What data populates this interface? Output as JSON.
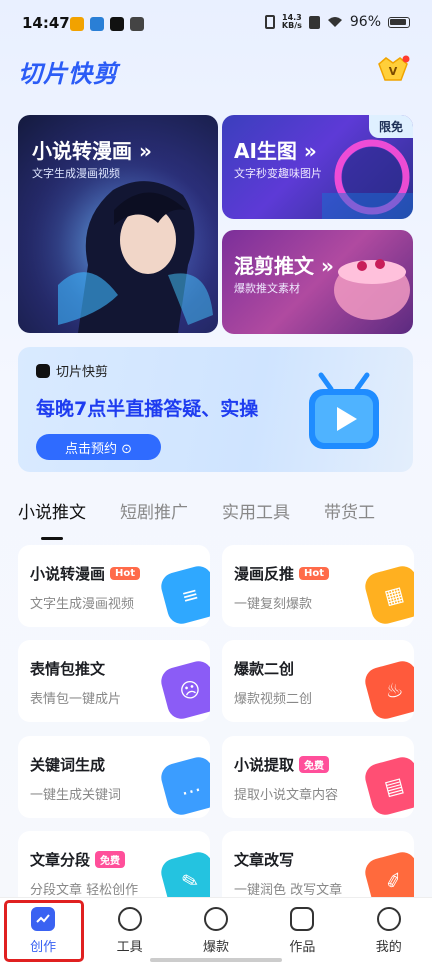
{
  "status": {
    "time": "14:47",
    "net_speed_top": "14.3",
    "net_speed_bottom": "KB/s",
    "battery": "96%"
  },
  "header": {
    "app_title": "切片快剪"
  },
  "hero": {
    "big": {
      "title": "小说转漫画 »",
      "subtitle": "文字生成漫画视频"
    },
    "ai": {
      "title": "AI生图 »",
      "subtitle": "文字秒变趣味图片",
      "badge": "限免"
    },
    "mix": {
      "title": "混剪推文 »",
      "subtitle": "爆款推文素材"
    }
  },
  "banner": {
    "brand": "切片快剪",
    "title": "每晚7点半直播答疑、实操",
    "button": "点击预约 ⊙"
  },
  "tabs": [
    "小说推文",
    "短剧推广",
    "实用工具",
    "带货工"
  ],
  "cards": [
    {
      "title": "小说转漫画",
      "tag": "Hot",
      "tag_type": "hot",
      "subtitle": "文字生成漫画视频",
      "icon": "document-icon",
      "color": "#2fa8ff"
    },
    {
      "title": "漫画反推",
      "tag": "Hot",
      "tag_type": "hot",
      "subtitle": "一键复刻爆款",
      "icon": "grid-icon",
      "color": "#ffb020"
    },
    {
      "title": "表情包推文",
      "tag": "",
      "tag_type": "",
      "subtitle": "表情包一键成片",
      "icon": "emoji-icon",
      "color": "#8b5cf6"
    },
    {
      "title": "爆款二创",
      "tag": "",
      "tag_type": "",
      "subtitle": "爆款视频二创",
      "icon": "flame-icon",
      "color": "#ff5a3c"
    },
    {
      "title": "关键词生成",
      "tag": "",
      "tag_type": "",
      "subtitle": "一键生成关键词",
      "icon": "chat-icon",
      "color": "#3b9dff"
    },
    {
      "title": "小说提取",
      "tag": "免费",
      "tag_type": "free",
      "subtitle": "提取小说文章内容",
      "icon": "book-icon",
      "color": "#ff4f74"
    },
    {
      "title": "文章分段",
      "tag": "免费",
      "tag_type": "free",
      "subtitle": "分段文章 轻松创作",
      "icon": "edit-icon",
      "color": "#24c3e0"
    },
    {
      "title": "文章改写",
      "tag": "",
      "tag_type": "",
      "subtitle": "一键润色 改写文章",
      "icon": "pen-icon",
      "color": "#ff6a3d"
    }
  ],
  "bottom_nav": [
    "创作",
    "工具",
    "爆款",
    "作品",
    "我的"
  ]
}
